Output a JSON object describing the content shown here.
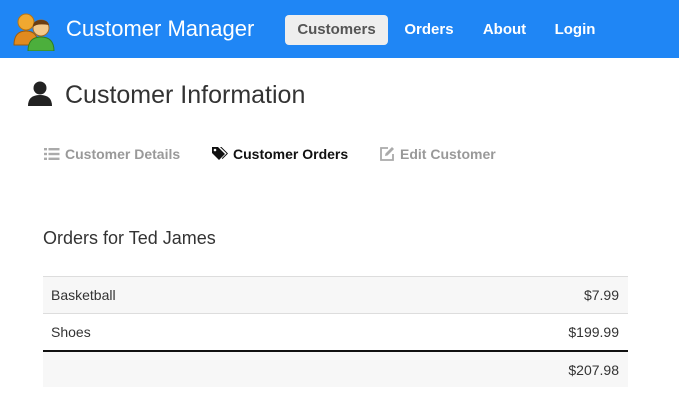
{
  "navbar": {
    "brand": "Customer Manager",
    "brand_icon": "users-logo-icon",
    "items": [
      {
        "label": "Customers",
        "active": true
      },
      {
        "label": "Orders",
        "active": false
      },
      {
        "label": "About",
        "active": false
      },
      {
        "label": "Login",
        "active": false
      }
    ],
    "colors": {
      "background": "#1f86f5",
      "active_bg": "#eeeeee"
    }
  },
  "page": {
    "title": "Customer Information",
    "icon": "user-icon"
  },
  "subnav": [
    {
      "label": "Customer Details",
      "icon": "list-icon",
      "active": false
    },
    {
      "label": "Customer Orders",
      "icon": "tags-icon",
      "active": true
    },
    {
      "label": "Edit Customer",
      "icon": "edit-icon",
      "active": false
    }
  ],
  "orders": {
    "heading": "Orders for Ted James",
    "rows": [
      {
        "product": "Basketball",
        "price": "$7.99"
      },
      {
        "product": "Shoes",
        "price": "$199.99"
      }
    ],
    "total": "$207.98"
  }
}
